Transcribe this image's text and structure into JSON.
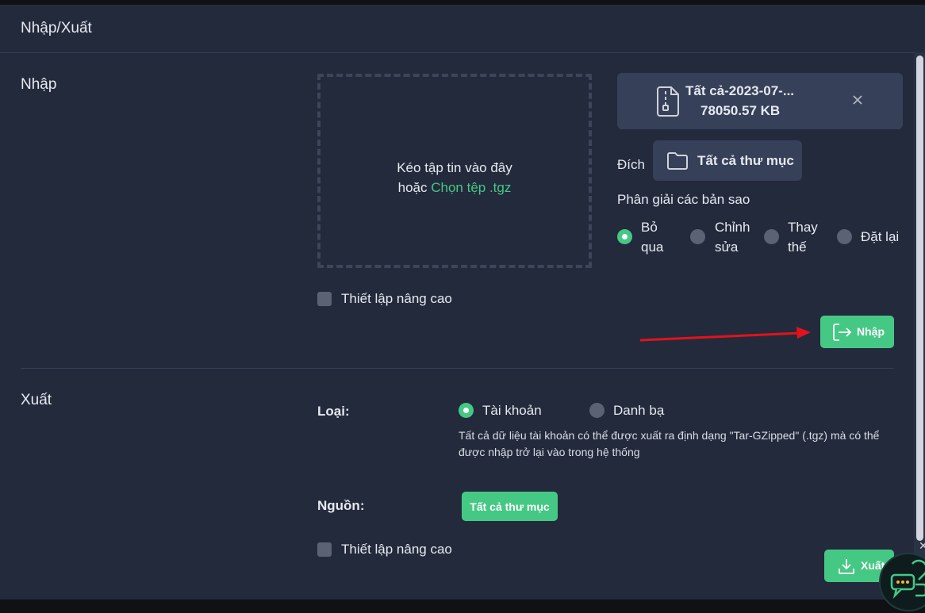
{
  "header": {
    "title": "Nhập/Xuất"
  },
  "import": {
    "section_label": "Nhập",
    "dropzone": {
      "line1": "Kéo tập tin vào đây",
      "line2_prefix": "hoặc ",
      "choose_link": "Chọn tệp .tgz"
    },
    "advanced_label": "Thiết lập nâng cao",
    "file": {
      "name": "Tất cả-2023-07-...",
      "size": "78050.57 KB"
    },
    "dest_label": "Đích",
    "dest_button": "Tất cả thư mục",
    "conflict_label": "Phân giải các bản sao",
    "conflict_options": [
      {
        "line1": "Bỏ",
        "line2": "qua",
        "selected": true
      },
      {
        "line1": "Chỉnh",
        "line2": "sửa",
        "selected": false
      },
      {
        "line1": "Thay",
        "line2": "thế",
        "selected": false
      },
      {
        "line1": "Đặt lại",
        "line2": "",
        "selected": false
      }
    ],
    "import_button": "Nhập"
  },
  "export": {
    "section_label": "Xuất",
    "type_label": "Loại:",
    "type_options": [
      {
        "label": "Tài khoản",
        "selected": true
      },
      {
        "label": "Danh bạ",
        "selected": false
      }
    ],
    "description": "Tất cả dữ liệu tài khoản có thể được xuất ra định dạng \"Tar-GZipped\" (.tgz) mà có thể được nhập trở lại vào trong hệ thống",
    "source_label": "Nguồn:",
    "source_button": "Tất cả thư mục",
    "advanced_label": "Thiết lập nâng cao",
    "export_button": "Xuất"
  },
  "colors": {
    "accent": "#46c885",
    "panel": "#232a3c",
    "card": "#364059",
    "arrow": "#e3121b"
  },
  "icons": [
    "file-zip-icon",
    "close-icon",
    "folder-icon",
    "import-icon",
    "download-icon",
    "chat-widget-icon"
  ]
}
